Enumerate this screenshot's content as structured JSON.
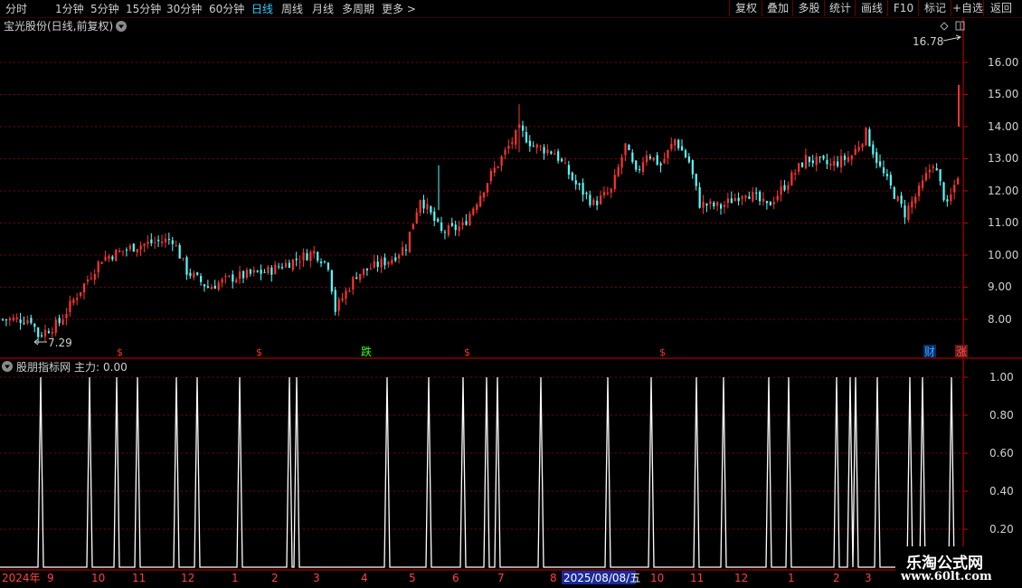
{
  "toolbar": {
    "periods": [
      "分时",
      "1分钟",
      "5分钟",
      "15分钟",
      "30分钟",
      "60分钟",
      "日线",
      "周线",
      "月线",
      "多周期",
      "更多"
    ],
    "more_arrow": ">",
    "active_period": "日线",
    "tools": [
      "复权",
      "叠加",
      "多股",
      "统计",
      "画线",
      "F10",
      "标记",
      "+自选",
      "返回"
    ]
  },
  "main_panel": {
    "stock_title": "宝光股份(日线,前复权)",
    "high_marker": "16.78",
    "low_marker": "7.29",
    "price_ticks": [
      "16.00",
      "15.00",
      "14.00",
      "13.00",
      "12.00",
      "11.00",
      "10.00",
      "9.00",
      "8.00"
    ],
    "event_markers": [
      {
        "text": "$",
        "color": "#ff3030"
      },
      {
        "text": "$",
        "color": "#ff3030"
      },
      {
        "text": "跌",
        "color": "#33ff33"
      },
      {
        "text": "$",
        "color": "#ff3030"
      },
      {
        "text": "$",
        "color": "#ff3030"
      },
      {
        "text": "财",
        "color": "#33aaff"
      },
      {
        "text": "涨",
        "color": "#ff5050"
      }
    ]
  },
  "indicator_panel": {
    "name": "股朋指标网",
    "main_label": "主力:",
    "main_value": "0.00",
    "ticks": [
      "1.00",
      "0.80",
      "0.60",
      "0.40",
      "0.20"
    ]
  },
  "time_axis": {
    "labels": [
      "2024年",
      "9",
      "10",
      "11",
      "12",
      "1",
      "2",
      "3",
      "4",
      "5",
      "6",
      "7",
      "8",
      "2025/08/08/五",
      "10",
      "11",
      "12",
      "1",
      "2",
      "3"
    ]
  },
  "watermark": {
    "line1": "乐淘公式网",
    "line2": "www.60lt.com"
  },
  "colors": {
    "up": "#ff3333",
    "down": "#54ffff",
    "background": "#000000",
    "grid": "#7a0000",
    "line": "#ffffff"
  },
  "chart_data": {
    "type": "candlestick",
    "ylim": [
      7.2,
      16.8
    ],
    "price_anchors": [
      [
        0,
        8.0
      ],
      [
        8,
        8.0
      ],
      [
        10,
        7.5
      ],
      [
        16,
        7.9
      ],
      [
        20,
        8.6
      ],
      [
        28,
        9.9
      ],
      [
        38,
        10.3
      ],
      [
        48,
        10.5
      ],
      [
        52,
        9.5
      ],
      [
        58,
        9.0
      ],
      [
        65,
        9.3
      ],
      [
        75,
        9.5
      ],
      [
        88,
        10.1
      ],
      [
        92,
        9.7
      ],
      [
        94,
        8.3
      ],
      [
        100,
        9.4
      ],
      [
        110,
        9.9
      ],
      [
        114,
        10.3
      ],
      [
        118,
        11.8
      ],
      [
        124,
        10.7
      ],
      [
        130,
        10.9
      ],
      [
        138,
        12.5
      ],
      [
        142,
        13.2
      ],
      [
        146,
        13.9
      ],
      [
        150,
        13.4
      ],
      [
        156,
        13.2
      ],
      [
        162,
        12.2
      ],
      [
        167,
        11.6
      ],
      [
        172,
        12.0
      ],
      [
        176,
        13.4
      ],
      [
        179,
        12.5
      ],
      [
        182,
        13.2
      ],
      [
        186,
        12.8
      ],
      [
        190,
        13.6
      ],
      [
        194,
        12.9
      ],
      [
        197,
        11.6
      ],
      [
        203,
        11.5
      ],
      [
        210,
        12.0
      ],
      [
        216,
        11.5
      ],
      [
        222,
        12.3
      ],
      [
        227,
        13.0
      ],
      [
        234,
        12.8
      ],
      [
        240,
        13.1
      ],
      [
        244,
        13.8
      ],
      [
        248,
        12.7
      ],
      [
        252,
        11.9
      ],
      [
        255,
        11.3
      ],
      [
        259,
        12.0
      ],
      [
        263,
        12.9
      ],
      [
        267,
        11.5
      ],
      [
        270,
        12.5
      ]
    ],
    "indicator_signals": [
      45,
      99,
      129,
      152,
      195,
      218,
      265,
      320,
      328,
      428,
      474,
      512,
      538,
      550,
      598,
      672,
      720,
      770,
      800,
      850,
      872,
      925,
      940,
      946,
      970,
      1006,
      1020,
      1052
    ],
    "indicator_range": [
      0,
      1
    ]
  }
}
